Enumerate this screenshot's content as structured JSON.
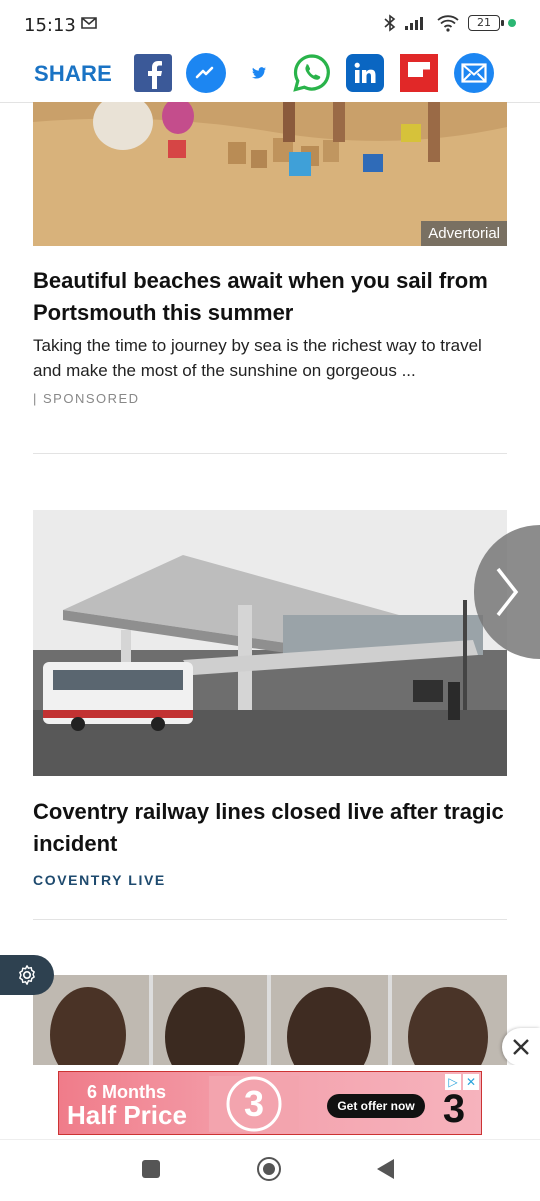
{
  "status_bar": {
    "time": "15:13",
    "battery": "21"
  },
  "share_bar": {
    "label": "SHARE",
    "icons": [
      "facebook-icon",
      "messenger-icon",
      "twitter-icon",
      "whatsapp-icon",
      "linkedin-icon",
      "flipboard-icon",
      "email-icon"
    ]
  },
  "articles": [
    {
      "badge": "Advertorial",
      "headline": "Beautiful beaches await when you sail from Portsmouth this summer",
      "description": "Taking the time to journey by sea is the richest way to travel and make the most of the sunshine on gorgeous ...",
      "tag": "| SPONSORED"
    },
    {
      "headline": "Coventry railway lines closed live after tragic incident",
      "source": "COVENTRY LIVE"
    }
  ],
  "ad_banner": {
    "line1": "6 Months",
    "line2": "Half Price",
    "cta": "Get offer now",
    "brand_glyph": "3"
  },
  "colors": {
    "share_blue": "#1a73c4",
    "source_blue": "#1e4a6e",
    "ad_pink": "#f07c8a"
  }
}
